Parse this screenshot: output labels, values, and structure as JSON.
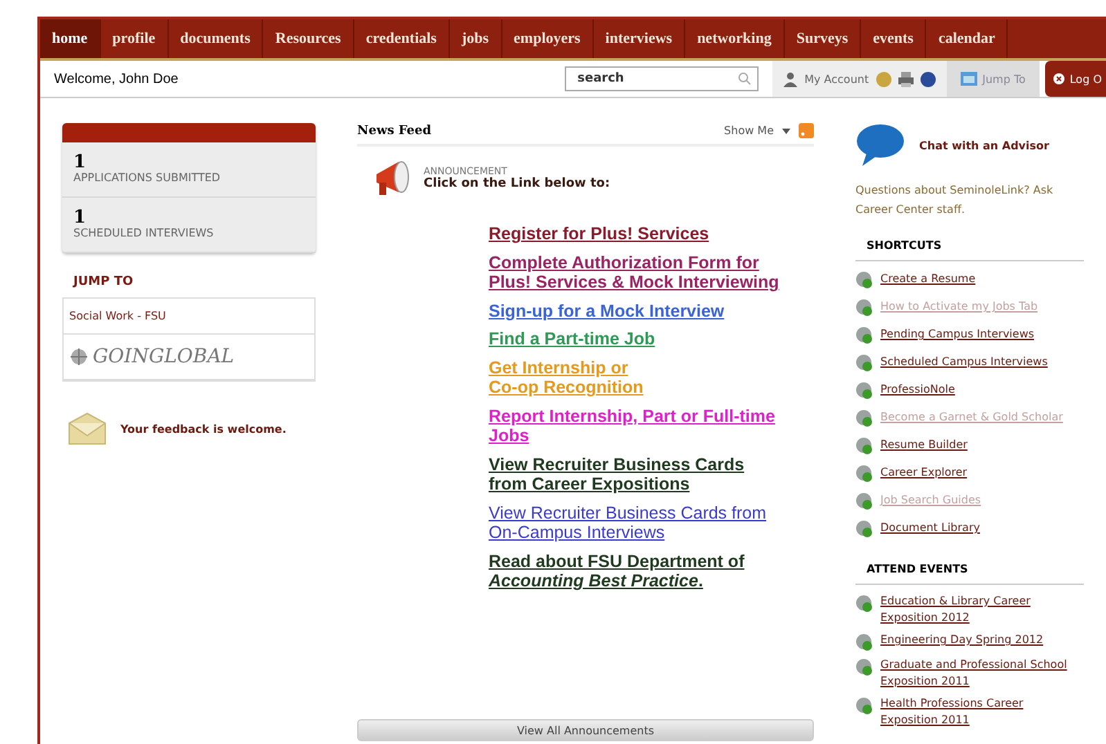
{
  "nav": {
    "tabs": [
      {
        "label": "home",
        "selected": true
      },
      {
        "label": "profile",
        "selected": false
      },
      {
        "label": "documents",
        "selected": false
      },
      {
        "label": "Resources",
        "selected": false
      },
      {
        "label": "credentials",
        "selected": false
      },
      {
        "label": "jobs",
        "selected": false
      },
      {
        "label": "employers",
        "selected": false
      },
      {
        "label": "interviews",
        "selected": false
      },
      {
        "label": "networking",
        "selected": false
      },
      {
        "label": "Surveys",
        "selected": false
      },
      {
        "label": "events",
        "selected": false
      },
      {
        "label": "calendar",
        "selected": false
      }
    ]
  },
  "toolbar": {
    "welcome": "Welcome, John Doe",
    "search": {
      "value": "search"
    },
    "account": "My Account",
    "jump": "Jump To",
    "logout": "Log O"
  },
  "stats": [
    {
      "count": "1",
      "label": "APPLICATIONS SUBMITTED"
    },
    {
      "count": "1",
      "label": "SCHEDULED INTERVIEWS"
    }
  ],
  "jump_to": {
    "title": "JUMP TO",
    "items": [
      {
        "label": "Social Work - FSU"
      },
      {
        "label": "GOINGLOBAL",
        "kind": "logo"
      }
    ]
  },
  "feedback": "Your feedback is welcome.",
  "news_feed": {
    "title": "News Feed",
    "show_me": "Show Me",
    "announcement": {
      "kicker": "ANNOUNCEMENT",
      "headline": "Click on the Link below to:"
    },
    "links": [
      {
        "text": "Register for Plus! Services",
        "color": "#8b1a2b"
      },
      {
        "text": "Complete Authorization Form for Plus! Services & Mock Interviewing",
        "color": "#9b2363"
      },
      {
        "text": "Sign-up for a Mock Interview",
        "color": "#3a63d8"
      },
      {
        "text": "Find a Part-time Job",
        "color": "#2f9a55"
      },
      {
        "lines": [
          "Get Internship or",
          "Co-op Recognition"
        ],
        "color": "#e59a1c"
      },
      {
        "text": "Report Internship, Part or Full-time Jobs",
        "color": "#e020c8"
      },
      {
        "text": "View Recruiter Business Cards from Career Expositions",
        "color": "#1f3a1f"
      },
      {
        "text": "View Recruiter Business Cards from On-Campus Interviews",
        "color": "#3a3ad0",
        "bold": false
      },
      {
        "text": "Read about FSU Department of *Accounting Best Practice*.",
        "color": "#1f3a1f"
      }
    ],
    "view_all": "View All Announcements"
  },
  "advisor": {
    "title": "Chat with an Advisor",
    "text": "Questions about SeminoleLink? Ask Career Center staff."
  },
  "shortcuts": {
    "title": "SHORTCUTS",
    "items": [
      {
        "label": "Create a Resume",
        "faded": false
      },
      {
        "label": "How to Activate my Jobs Tab",
        "faded": true
      },
      {
        "label": "Pending Campus Interviews",
        "faded": false
      },
      {
        "label": "Scheduled Campus Interviews",
        "faded": false
      },
      {
        "label": "ProfessioNole",
        "faded": false
      },
      {
        "label": "Become a Garnet & Gold Scholar",
        "faded": true
      },
      {
        "label": "Resume Builder",
        "faded": false
      },
      {
        "label": "Career Explorer",
        "faded": false
      },
      {
        "label": "Job Search Guides",
        "faded": true
      },
      {
        "label": "Document Library",
        "faded": false
      }
    ]
  },
  "events": {
    "title": "ATTEND EVENTS",
    "items": [
      {
        "label": "Education & Library Career Exposition 2012"
      },
      {
        "label": "Engineering Day Spring 2012"
      },
      {
        "label": "Graduate and Professional School Exposition 2011"
      },
      {
        "label": "Health Professions Career Exposition 2011"
      }
    ]
  }
}
